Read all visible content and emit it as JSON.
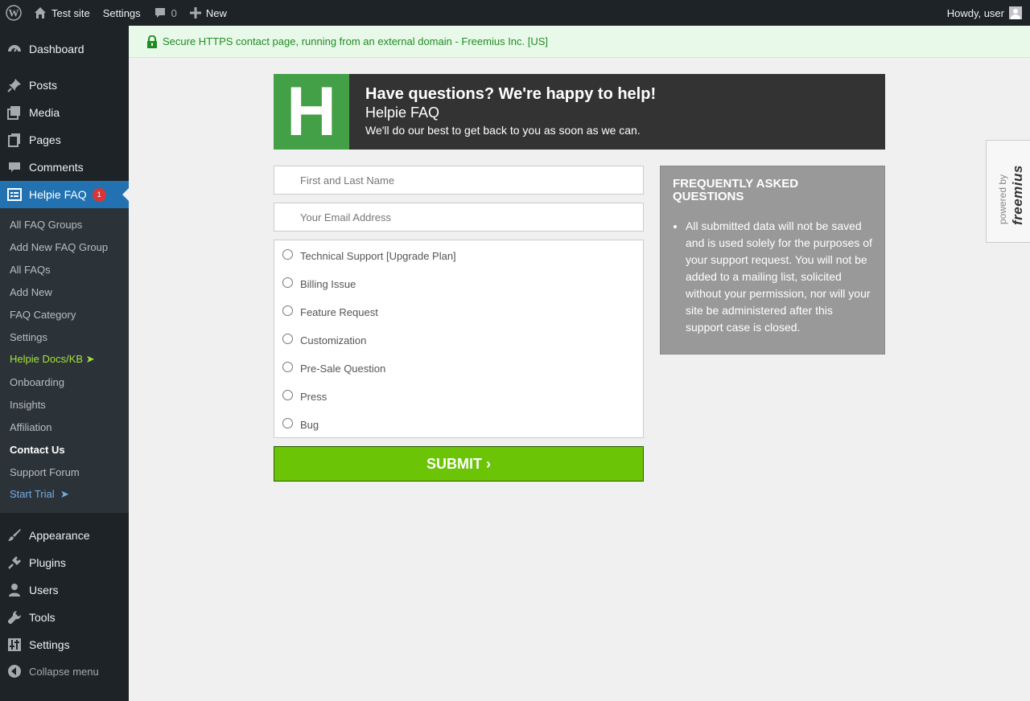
{
  "adminbar": {
    "site_name": "Test site",
    "settings": "Settings",
    "comments_count": "0",
    "new": "New",
    "greeting": "Howdy, user"
  },
  "sidebar": {
    "items": [
      {
        "label": "Dashboard",
        "icon": "dashboard-icon"
      },
      {
        "label": "Posts",
        "icon": "pushpin-icon"
      },
      {
        "label": "Media",
        "icon": "media-icon"
      },
      {
        "label": "Pages",
        "icon": "pages-icon"
      },
      {
        "label": "Comments",
        "icon": "comment-icon"
      },
      {
        "label": "Helpie FAQ",
        "icon": "faq-icon",
        "badge": "1"
      }
    ],
    "submenu": [
      {
        "label": "All FAQ Groups"
      },
      {
        "label": "Add New FAQ Group"
      },
      {
        "label": "All FAQs"
      },
      {
        "label": "Add New"
      },
      {
        "label": "FAQ Category"
      },
      {
        "label": "Settings"
      },
      {
        "label": "Helpie Docs/KB ➤"
      },
      {
        "label": "Onboarding"
      },
      {
        "label": "Insights"
      },
      {
        "label": "Affiliation"
      },
      {
        "label": "Contact Us"
      },
      {
        "label": "Support Forum"
      },
      {
        "label": "Start Trial  ➤"
      }
    ],
    "items_bottom": [
      {
        "label": "Appearance",
        "icon": "brush-icon"
      },
      {
        "label": "Plugins",
        "icon": "plug-icon"
      },
      {
        "label": "Users",
        "icon": "user-icon"
      },
      {
        "label": "Tools",
        "icon": "wrench-icon"
      },
      {
        "label": "Settings",
        "icon": "sliders-icon"
      }
    ],
    "collapse": "Collapse menu"
  },
  "notice": {
    "text": "Secure HTTPS contact page, running from an external domain - Freemius Inc. [US]"
  },
  "banner": {
    "logo_letter": "H",
    "title": "Have questions? We're happy to help!",
    "plugin_name": "Helpie FAQ",
    "subtitle": "We'll do our best to get back to you as soon as we can."
  },
  "form": {
    "name_placeholder": "First and Last Name",
    "email_placeholder": "Your Email Address",
    "options": [
      "Technical Support [Upgrade Plan]",
      "Billing Issue",
      "Feature Request",
      "Customization",
      "Pre-Sale Question",
      "Press",
      "Bug"
    ],
    "submit": "SUBMIT ›"
  },
  "faq": {
    "heading": "FREQUENTLY ASKED QUESTIONS",
    "items": [
      "All submitted data will not be saved and is used solely for the purposes of your support request. You will not be added to a mailing list, solicited without your permission, nor will your site be administered after this support case is closed."
    ]
  },
  "freemius": {
    "powered_by": "powered by",
    "brand": "freemius"
  },
  "colors": {
    "accent": "#2271b1",
    "submit": "#6bc406",
    "logo_bg": "#43a047",
    "notice_text": "#1f8c23"
  }
}
